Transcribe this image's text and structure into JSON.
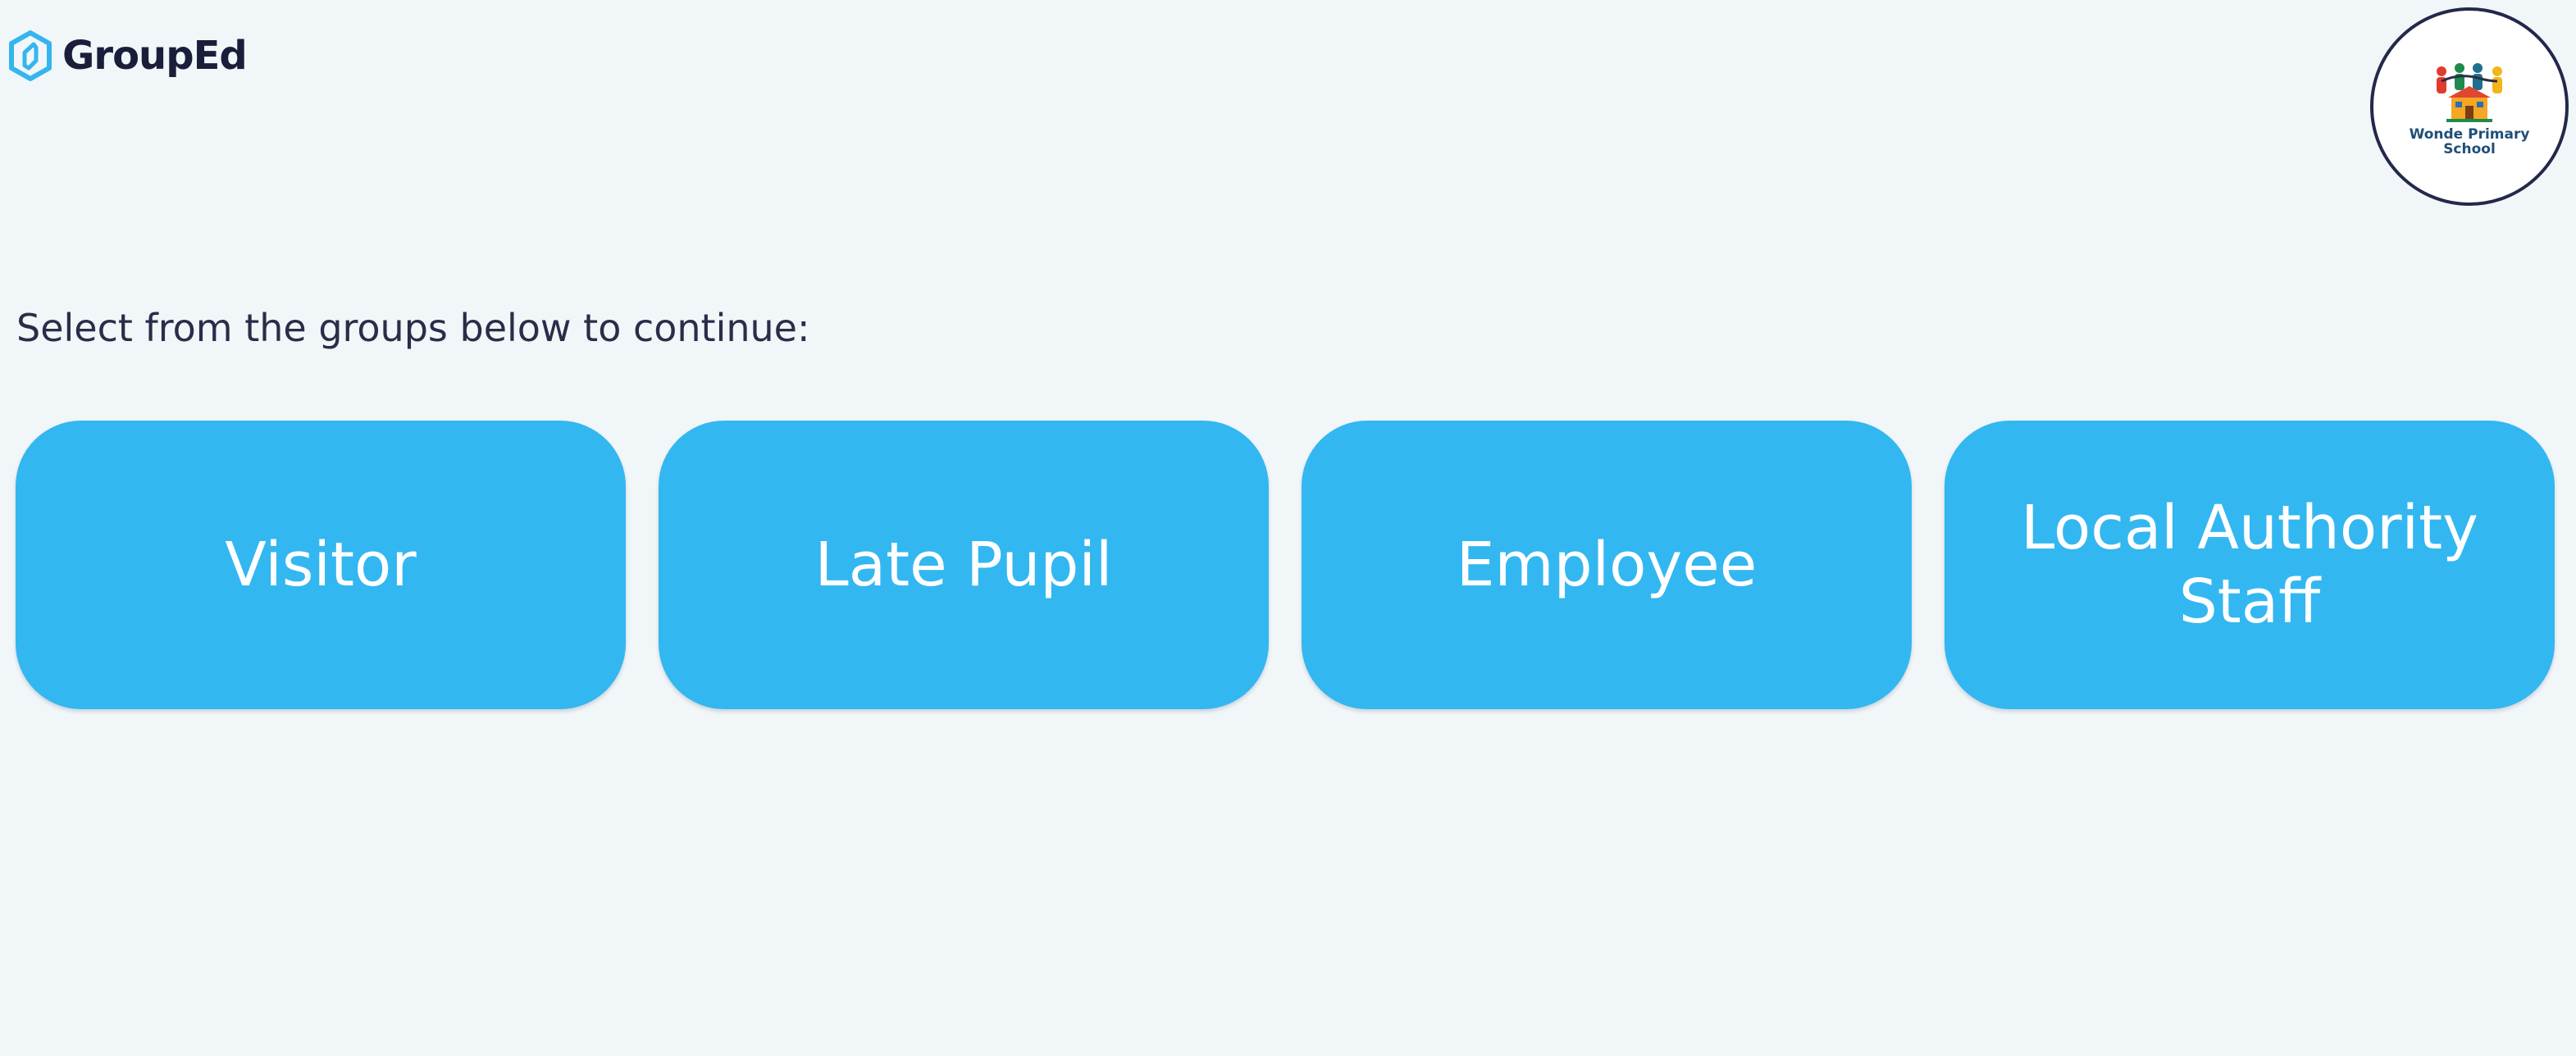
{
  "brand": {
    "name": "GroupEd",
    "icon": "hexagon-logo-icon",
    "accent": "#33b7f1"
  },
  "school": {
    "name": "Wonde Primary School",
    "emblem": "school-children-emblem"
  },
  "prompt": "Select from the groups below to continue:",
  "groups": [
    {
      "label": "Visitor"
    },
    {
      "label": "Late Pupil"
    },
    {
      "label": "Employee"
    },
    {
      "label": "Local Authority\nStaff"
    }
  ],
  "colors": {
    "background": "#f1f6f9",
    "button": "#33b7f1",
    "button_text": "#ffffff",
    "text": "#2a2d48"
  }
}
